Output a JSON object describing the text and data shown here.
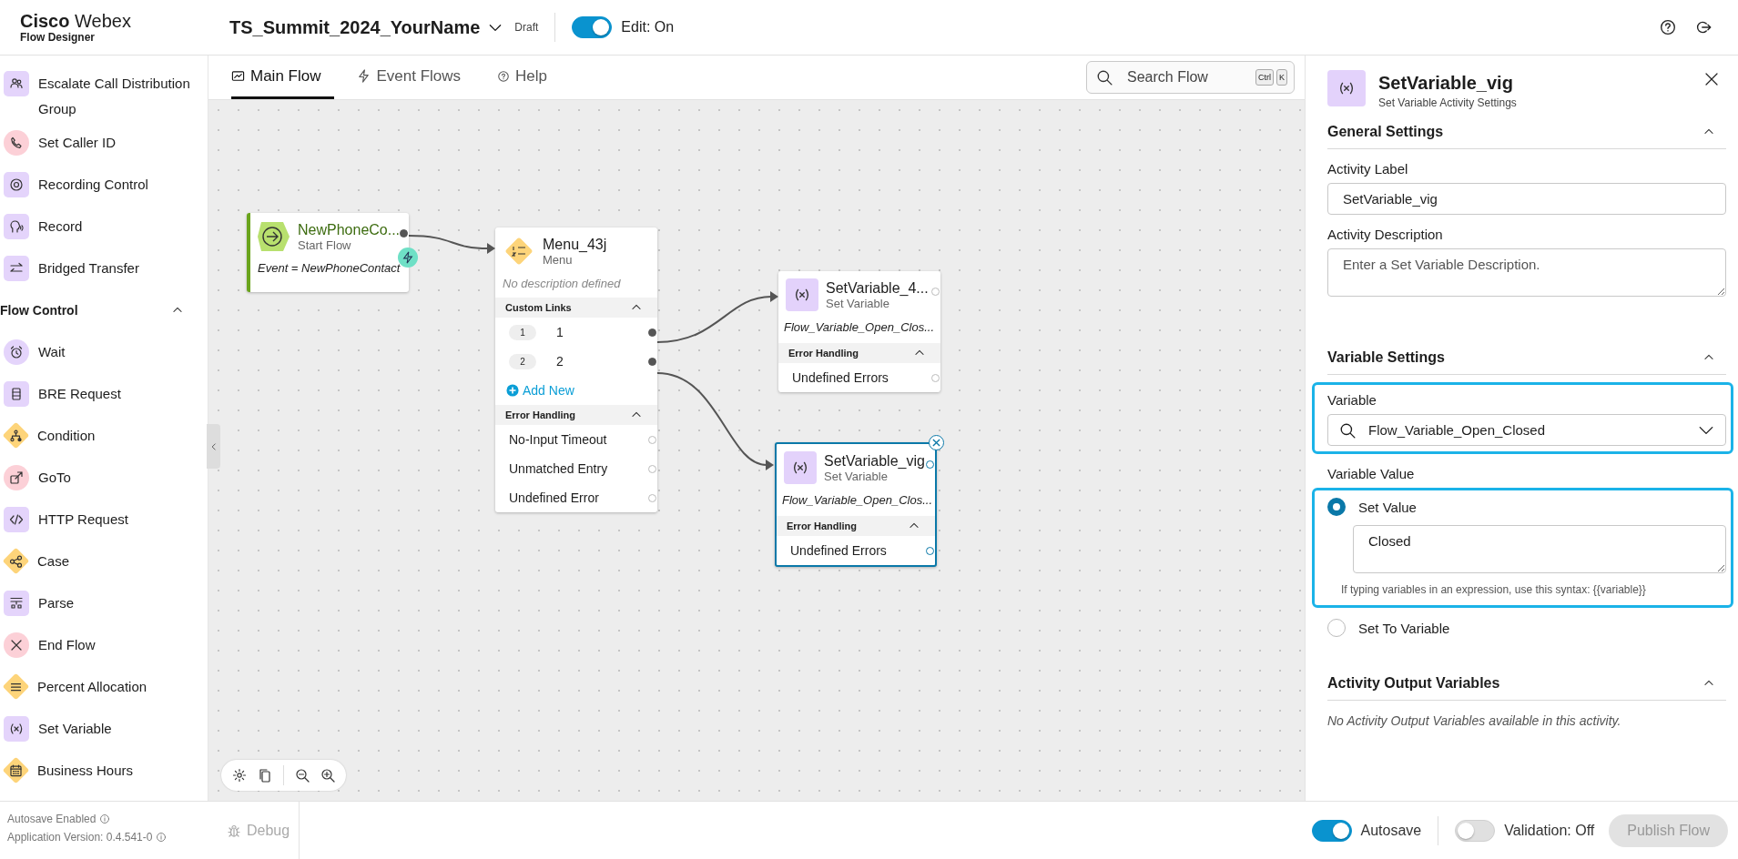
{
  "header": {
    "brand": "Cisco",
    "product": "Webex",
    "subtitle": "Flow Designer",
    "flow_name": "TS_Summit_2024_YourName",
    "status": "Draft",
    "edit_toggle": {
      "label": "Edit: On",
      "on": true
    }
  },
  "sidebar": {
    "items": [
      {
        "label": "Escalate Call Distribution Group",
        "kind": "square",
        "color": "#e4d4fb"
      },
      {
        "label": "Set Caller ID",
        "kind": "circle",
        "color": "#fcd0d7"
      },
      {
        "label": "Recording Control",
        "kind": "square",
        "color": "#e4d4fb"
      },
      {
        "label": "Record",
        "kind": "square",
        "color": "#e4d4fb"
      },
      {
        "label": "Bridged Transfer",
        "kind": "square",
        "color": "#e4d4fb"
      }
    ],
    "sections": [
      {
        "title": "Flow Control",
        "expanded": true,
        "items": [
          {
            "label": "Wait",
            "kind": "circle",
            "color": "#e4d4fb"
          },
          {
            "label": "BRE Request",
            "kind": "square",
            "color": "#e4d4fb"
          },
          {
            "label": "Condition",
            "kind": "diamond",
            "color": "#fdd47a"
          },
          {
            "label": "GoTo",
            "kind": "circle",
            "color": "#fcd0d7"
          },
          {
            "label": "HTTP Request",
            "kind": "square",
            "color": "#e4d4fb"
          },
          {
            "label": "Case",
            "kind": "diamond",
            "color": "#fdd47a"
          },
          {
            "label": "Parse",
            "kind": "square",
            "color": "#e4d4fb"
          },
          {
            "label": "End Flow",
            "kind": "circle",
            "color": "#fcd0d7"
          },
          {
            "label": "Percent Allocation",
            "kind": "diamond",
            "color": "#fdd47a"
          },
          {
            "label": "Set Variable",
            "kind": "square",
            "color": "#e4d4fb"
          },
          {
            "label": "Business Hours",
            "kind": "diamond",
            "color": "#fdd47a"
          }
        ]
      }
    ],
    "footer": {
      "autosave_status": "Autosave Enabled",
      "version": "Application Version: 0.4.541-0"
    }
  },
  "tabs": [
    {
      "label": "Main Flow",
      "selected": true
    },
    {
      "label": "Event Flows",
      "selected": false
    },
    {
      "label": "Help",
      "selected": false
    }
  ],
  "search": {
    "placeholder": "Search Flow",
    "shortcut": [
      "Ctrl",
      "K"
    ]
  },
  "canvas": {
    "nodes": [
      {
        "kind": "start",
        "title": "NewPhoneCo...",
        "subtitle": "Start Flow",
        "event": "Event = NewPhoneContact",
        "selected": false
      },
      {
        "kind": "menu",
        "title": "Menu_43j",
        "subtitle": "Menu",
        "description": "No description defined",
        "selected": false,
        "custom_links": {
          "title": "Custom Links",
          "expanded": true,
          "links": [
            {
              "badge": "1",
              "label": "1"
            },
            {
              "badge": "2",
              "label": "2"
            }
          ],
          "add_label": "Add New"
        },
        "error_handling": {
          "title": "Error Handling",
          "expanded": true,
          "rows": [
            "No-Input Timeout",
            "Unmatched Entry",
            "Undefined Error"
          ]
        }
      },
      {
        "kind": "set_variable",
        "title": "SetVariable_4...",
        "subtitle": "Set Variable",
        "variable": "Flow_Variable_Open_Clos...",
        "selected": false,
        "error_handling": {
          "title": "Error Handling",
          "expanded": true,
          "rows": [
            "Undefined Errors"
          ]
        }
      },
      {
        "kind": "set_variable",
        "title": "SetVariable_vig",
        "subtitle": "Set Variable",
        "variable": "Flow_Variable_Open_Clos...",
        "selected": true,
        "error_handling": {
          "title": "Error Handling",
          "expanded": true,
          "rows": [
            "Undefined Errors"
          ]
        }
      }
    ]
  },
  "panel": {
    "title": "SetVariable_vig",
    "subtitle": "Set Variable Activity Settings",
    "general_settings": {
      "title": "General Settings",
      "expanded": true,
      "activity_label": {
        "label": "Activity Label",
        "value": "SetVariable_vig"
      },
      "activity_description": {
        "label": "Activity Description",
        "placeholder": "Enter a Set Variable Description."
      }
    },
    "variable_settings": {
      "title": "Variable Settings",
      "expanded": true,
      "variable": {
        "label": "Variable",
        "value": "Flow_Variable_Open_Closed"
      },
      "variable_value": {
        "label": "Variable Value",
        "options": [
          {
            "label": "Set Value",
            "selected": true
          },
          {
            "label": "Set To Variable",
            "selected": false
          }
        ],
        "value": "Closed",
        "hint": "If typing variables in an expression, use this syntax: {{variable}}"
      }
    },
    "output_variables": {
      "title": "Activity Output Variables",
      "expanded": true,
      "empty_text": "No Activity Output Variables available in this activity."
    }
  },
  "bottom_bar": {
    "debug": {
      "label": "Debug",
      "disabled": true
    },
    "autosave": {
      "label": "Autosave",
      "on": true
    },
    "validation": {
      "label": "Validation: Off",
      "on": false
    },
    "publish": {
      "label": "Publish Flow",
      "disabled": true
    }
  }
}
